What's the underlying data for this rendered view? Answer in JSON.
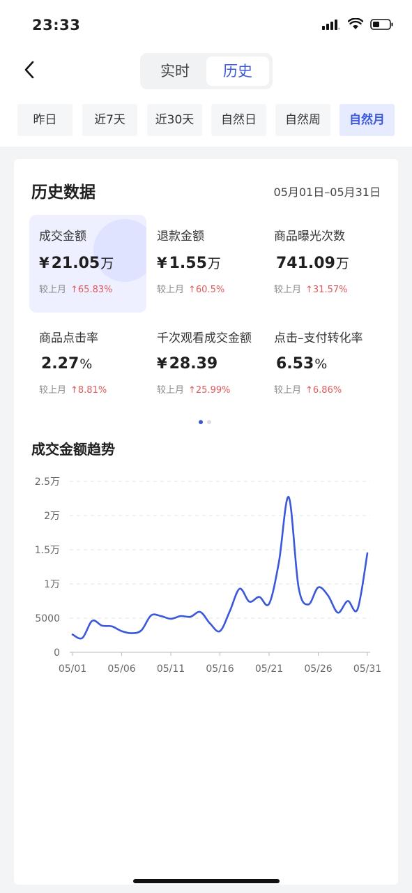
{
  "status_bar": {
    "time": "23:33"
  },
  "nav": {
    "tabs": [
      {
        "label": "实时",
        "active": false
      },
      {
        "label": "历史",
        "active": true
      }
    ]
  },
  "ranges": [
    {
      "label": "昨日",
      "active": false
    },
    {
      "label": "近7天",
      "active": false
    },
    {
      "label": "近30天",
      "active": false
    },
    {
      "label": "自然日",
      "active": false
    },
    {
      "label": "自然周",
      "active": false
    },
    {
      "label": "自然月",
      "active": true
    }
  ],
  "card": {
    "title": "历史数据",
    "date_range": "05月01日–05月31日",
    "metrics": [
      {
        "label": "成交金额",
        "prefix": "¥",
        "value": "21.05",
        "unit": "万",
        "compare_label": "较上月",
        "change": "↑65.83%"
      },
      {
        "label": "退款金额",
        "prefix": "¥",
        "value": "1.55",
        "unit": "万",
        "compare_label": "较上月",
        "change": "↑60.5%"
      },
      {
        "label": "商品曝光次数",
        "prefix": "",
        "value": "741.09",
        "unit": "万",
        "compare_label": "较上月",
        "change": "↑31.57%"
      },
      {
        "label": "商品点击率",
        "prefix": "",
        "value": "2.27",
        "unit": "%",
        "compare_label": "较上月",
        "change": "↑8.81%"
      },
      {
        "label": "千次观看成交金额",
        "prefix": "¥",
        "value": "28.39",
        "unit": "",
        "compare_label": "较上月",
        "change": "↑25.99%"
      },
      {
        "label": "点击–支付转化率",
        "prefix": "",
        "value": "6.53",
        "unit": "%",
        "compare_label": "较上月",
        "change": "↑6.86%"
      }
    ],
    "page_indicator": {
      "total": 2,
      "current": 1
    }
  },
  "trend": {
    "title": "成交金额趋势"
  },
  "chart_data": {
    "type": "line",
    "title": "成交金额趋势",
    "y_tick_labels": [
      "0",
      "5000",
      "1万",
      "1.5万",
      "2万",
      "2.5万"
    ],
    "y_tick_values": [
      0,
      5000,
      10000,
      15000,
      20000,
      25000
    ],
    "ylim": [
      0,
      25000
    ],
    "x_tick_labels": [
      "05/01",
      "05/06",
      "05/11",
      "05/16",
      "05/21",
      "05/26",
      "05/31"
    ],
    "x": [
      "05/01",
      "05/02",
      "05/03",
      "05/04",
      "05/05",
      "05/06",
      "05/07",
      "05/08",
      "05/09",
      "05/10",
      "05/11",
      "05/12",
      "05/13",
      "05/14",
      "05/15",
      "05/16",
      "05/17",
      "05/18",
      "05/19",
      "05/20",
      "05/21",
      "05/22",
      "05/23",
      "05/24",
      "05/25",
      "05/26",
      "05/27",
      "05/28",
      "05/29",
      "05/30",
      "05/31"
    ],
    "values": [
      2600,
      2100,
      4600,
      3900,
      3800,
      3100,
      2800,
      3200,
      5400,
      5300,
      4900,
      5300,
      5200,
      5900,
      4200,
      3100,
      6000,
      9300,
      7400,
      8100,
      7100,
      13200,
      22700,
      9500,
      7000,
      9500,
      8300,
      5800,
      7500,
      6300,
      14500
    ],
    "grid": true,
    "grid_style": "dashed",
    "line_color": "#3a58d8"
  }
}
